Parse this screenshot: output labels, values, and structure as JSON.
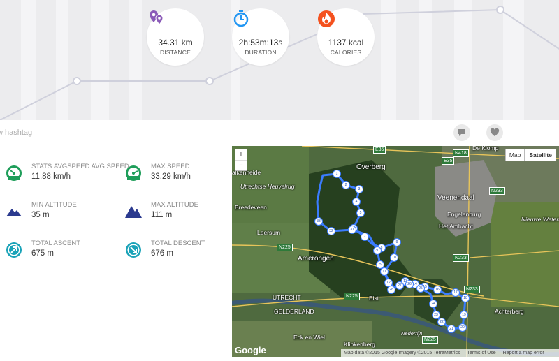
{
  "stats": [
    {
      "icon": "location-pins-icon",
      "value": "34.31 km",
      "label": "DISTANCE"
    },
    {
      "icon": "stopwatch-icon",
      "value": "2h:53m:13s",
      "label": "DURATION"
    },
    {
      "icon": "flame-icon",
      "value": "1137 kcal",
      "label": "CALORIES"
    }
  ],
  "hashtag_placeholder": "w hashtag",
  "metrics": [
    {
      "icon": "speedometer-icon",
      "label": "STATS.AVGSPEED AVG SPEED",
      "value": "11.88 km/h"
    },
    {
      "icon": "speedometer-icon",
      "label": "MAX SPEED",
      "value": "33.29 km/h"
    },
    {
      "icon": "mountain-icon",
      "label": "MIN ALTITUDE",
      "value": "35 m"
    },
    {
      "icon": "mountain-icon",
      "label": "MAX ALTITUDE",
      "value": "111 m"
    },
    {
      "icon": "arrow-up-right-icon",
      "label": "TOTAL ASCENT",
      "value": "675 m"
    },
    {
      "icon": "arrow-down-right-icon",
      "label": "TOTAL DESCENT",
      "value": "676 m"
    }
  ],
  "map": {
    "zoom_in": "+",
    "zoom_out": "−",
    "type_map": "Map",
    "type_satellite": "Satellite",
    "selected_type": "Satellite",
    "logo": "Google",
    "footer_data": "Map data ©2015 Google Imagery ©2015 TerraMetrics",
    "footer_terms": "Terms of Use",
    "footer_report": "Report a map error",
    "labels": {
      "overberg": "Overberg",
      "veenendaal": "Veenendaal",
      "engelenburg": "Engelenburg",
      "het_ambacht": "Het Ambacht",
      "utrechtse_heuvelrug": "Utrechtse Heuvelrug",
      "breedeveen": "Breedeveen",
      "leersum": "Leersum",
      "amerongen": "Amerongen",
      "utrecht": "UTRECHT",
      "gelderland": "GELDERLAND",
      "eist": "Eist",
      "eck_en_wiel": "Eck en Wiel",
      "klinkenberg": "Klinkenberg",
      "achterberg": "Achterberg",
      "nieuwe_wetering": "Nieuwe Wetering",
      "utrecht_v": "UTRECHT",
      "gelderland_v": "GELDERL",
      "de_klomp": "De Klomp",
      "alkenheide": "alkenheide",
      "nederrijn": "Nederrijn"
    },
    "roads": {
      "n225a": "N225",
      "n225b": "N225",
      "n225c": "N225",
      "n233a": "N233",
      "n233b": "N233",
      "n233c": "N233",
      "n418": "N418",
      "e35": "E35",
      "e35b": "E35"
    },
    "markers": [
      "1",
      "2",
      "3",
      "4",
      "5",
      "6",
      "7",
      "8",
      "9",
      "10",
      "11",
      "12",
      "13",
      "14",
      "15",
      "16",
      "17",
      "18",
      "19",
      "20",
      "21",
      "22",
      "23",
      "24",
      "25",
      "26",
      "27",
      "28",
      "29",
      "30",
      "31",
      "32",
      "33"
    ]
  },
  "colors": {
    "accent_purple": "#8b5bb8",
    "accent_blue": "#2196f3",
    "accent_orange": "#f4511e",
    "metric_teal": "#1aa3b8",
    "metric_navy": "#2b3a8f",
    "route_blue": "#3b7cff"
  }
}
